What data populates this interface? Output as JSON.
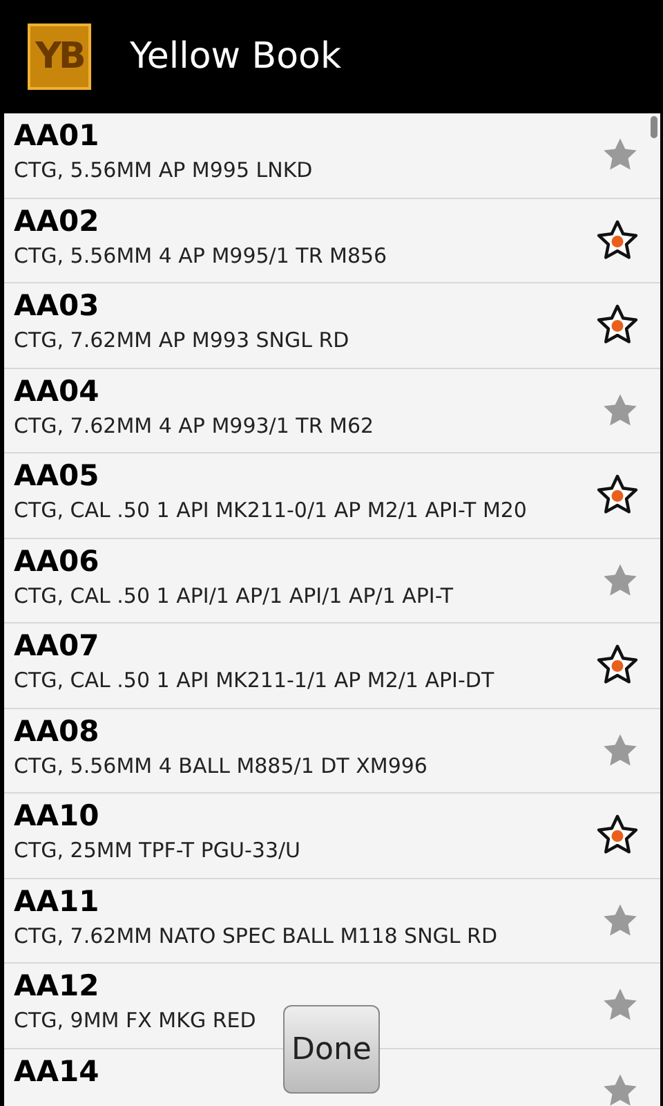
{
  "app_bar": {
    "logo": "YB",
    "title": "Yellow Book"
  },
  "items": [
    {
      "code": "AA01",
      "description": "CTG, 5.56MM AP M995 LNKD",
      "starred": false
    },
    {
      "code": "AA02",
      "description": "CTG, 5.56MM 4 AP M995/1 TR M856",
      "starred": true
    },
    {
      "code": "AA03",
      "description": "CTG, 7.62MM AP M993 SNGL RD",
      "starred": true
    },
    {
      "code": "AA04",
      "description": "CTG, 7.62MM 4 AP M993/1 TR M62",
      "starred": false
    },
    {
      "code": "AA05",
      "description": "CTG, CAL .50 1 API MK211-0/1 AP M2/1 API-T M20",
      "starred": true
    },
    {
      "code": "AA06",
      "description": "CTG, CAL .50 1 API/1 AP/1 API/1 AP/1 API-T",
      "starred": false
    },
    {
      "code": "AA07",
      "description": "CTG, CAL .50 1 API MK211-1/1 AP M2/1 API-DT",
      "starred": true
    },
    {
      "code": "AA08",
      "description": "CTG, 5.56MM 4 BALL M885/1 DT XM996",
      "starred": false
    },
    {
      "code": "AA10",
      "description": "CTG, 25MM TPF-T PGU-33/U",
      "starred": true
    },
    {
      "code": "AA11",
      "description": "CTG, 7.62MM NATO SPEC BALL M118 SNGL RD",
      "starred": false
    },
    {
      "code": "AA12",
      "description": "CTG, 9MM FX MKG RED",
      "starred": false
    },
    {
      "code": "AA14",
      "starred": false
    }
  ],
  "done_button": "Done"
}
